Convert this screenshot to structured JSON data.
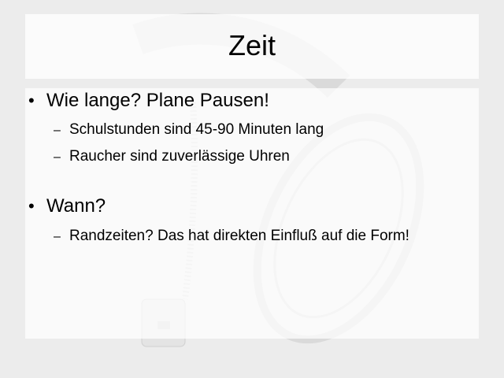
{
  "slide": {
    "title": "Zeit",
    "bullets": [
      {
        "text": "Wie lange? Plane Pausen!",
        "sub": [
          "Schulstunden sind 45-90 Minuten lang",
          "Raucher sind zuverlässige Uhren"
        ]
      },
      {
        "text": "Wann?",
        "sub": [
          "Randzeiten? Das hat direkten Einfluß auf die Form!"
        ]
      }
    ],
    "bullet_glyph": "•",
    "sub_glyph": "–"
  },
  "colors": {
    "background": "#ececec",
    "text": "#000000",
    "panel": "#ffffff"
  }
}
